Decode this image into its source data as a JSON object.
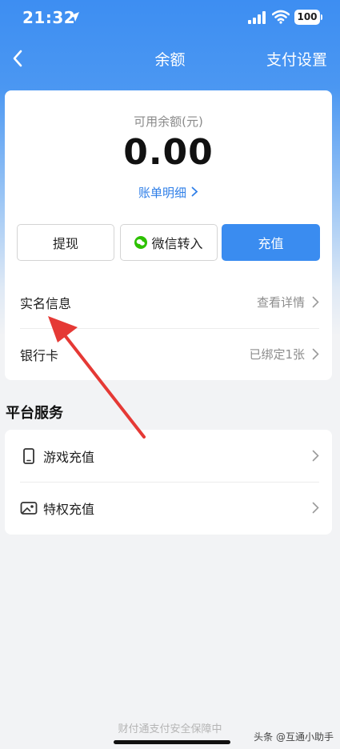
{
  "status": {
    "time": "21:32",
    "battery": "100"
  },
  "nav": {
    "title": "余额",
    "right_label": "支付设置"
  },
  "balance": {
    "label": "可用余额(元)",
    "amount": "0.00",
    "bill_link": "账单明细"
  },
  "actions": {
    "withdraw": "提现",
    "wechat_transfer": "微信转入",
    "recharge": "充值"
  },
  "info_rows": [
    {
      "label": "实名信息",
      "value": "查看详情"
    },
    {
      "label": "银行卡",
      "value": "已绑定1张"
    }
  ],
  "platform": {
    "title": "平台服务",
    "items": [
      {
        "label": "游戏充值",
        "icon": "phone-icon"
      },
      {
        "label": "特权充值",
        "icon": "photo-card-icon"
      }
    ]
  },
  "footer": {
    "text": "财付通支付安全保障中"
  },
  "watermark": "头条 @互通小助手",
  "colors": {
    "primary": "#3a8cf0",
    "link": "#2f7fe8",
    "annotation_arrow": "#e53935"
  }
}
